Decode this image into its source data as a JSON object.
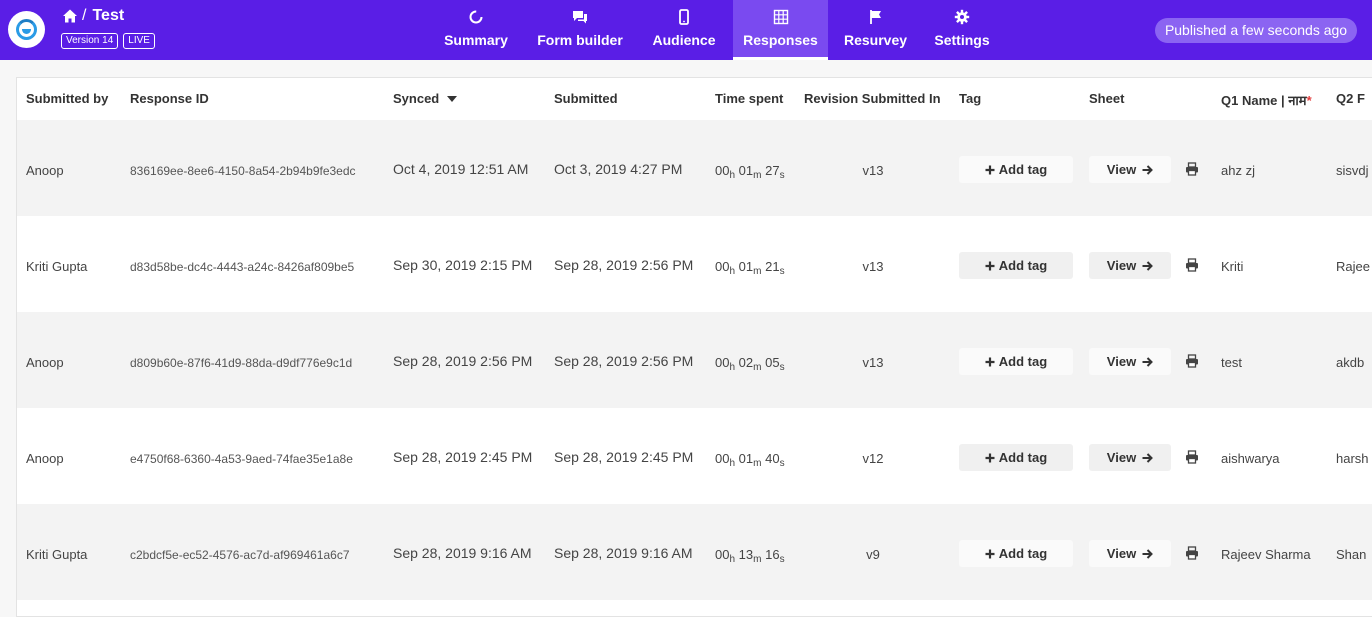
{
  "header": {
    "title": "Test",
    "version_badge": "Version 14",
    "live_badge": "LIVE",
    "published_status": "Published a few seconds ago",
    "colors": {
      "bar": "#5a1ee6",
      "active_tab": "#7a4af0",
      "pill": "#8b64f2"
    }
  },
  "nav": {
    "tabs": [
      {
        "label": "Summary",
        "icon": "summary-icon"
      },
      {
        "label": "Form builder",
        "icon": "chat-icon"
      },
      {
        "label": "Audience",
        "icon": "phone-icon"
      },
      {
        "label": "Responses",
        "icon": "grid-icon",
        "active": true
      },
      {
        "label": "Resurvey",
        "icon": "flag-icon"
      },
      {
        "label": "Settings",
        "icon": "gear-icon"
      }
    ]
  },
  "table": {
    "columns": {
      "submitted_by": "Submitted by",
      "response_id": "Response ID",
      "synced": "Synced",
      "submitted": "Submitted",
      "time_spent": "Time spent",
      "revision": "Revision Submitted In",
      "tag": "Tag",
      "sheet": "Sheet",
      "q1": "Q1 Name | नाम",
      "q1_required_mark": "*",
      "q2": "Q2 F"
    },
    "add_tag_label": "Add tag",
    "view_label": "View",
    "time_units": {
      "h": "h",
      "m": "m",
      "s": "s"
    },
    "rows": [
      {
        "submitted_by": "Anoop",
        "response_id": "836169ee-8ee6-4150-8a54-2b94b9fe3edc",
        "synced": "Oct 4, 2019 12:51 AM",
        "submitted": "Oct 3, 2019 4:27 PM",
        "t_h": "00",
        "t_m": "01",
        "t_s": "27",
        "revision": "v13",
        "q1": "ahz zj",
        "q2": "sisvdj"
      },
      {
        "submitted_by": "Kriti Gupta",
        "response_id": "d83d58be-dc4c-4443-a24c-8426af809be5",
        "synced": "Sep 30, 2019 2:15 PM",
        "submitted": "Sep 28, 2019 2:56 PM",
        "t_h": "00",
        "t_m": "01",
        "t_s": "21",
        "revision": "v13",
        "q1": "Kriti",
        "q2": "Rajee"
      },
      {
        "submitted_by": "Anoop",
        "response_id": "d809b60e-87f6-41d9-88da-d9df776e9c1d",
        "synced": "Sep 28, 2019 2:56 PM",
        "submitted": "Sep 28, 2019 2:56 PM",
        "t_h": "00",
        "t_m": "02",
        "t_s": "05",
        "revision": "v13",
        "q1": "test",
        "q2": "akdb"
      },
      {
        "submitted_by": "Anoop",
        "response_id": "e4750f68-6360-4a53-9aed-74fae35e1a8e",
        "synced": "Sep 28, 2019 2:45 PM",
        "submitted": "Sep 28, 2019 2:45 PM",
        "t_h": "00",
        "t_m": "01",
        "t_s": "40",
        "revision": "v12",
        "q1": "aishwarya",
        "q2": "harsh"
      },
      {
        "submitted_by": "Kriti Gupta",
        "response_id": "c2bdcf5e-ec52-4576-ac7d-af969461a6c7",
        "synced": "Sep 28, 2019 9:16 AM",
        "submitted": "Sep 28, 2019 9:16 AM",
        "t_h": "00",
        "t_m": "13",
        "t_s": "16",
        "revision": "v9",
        "q1": "Rajeev Sharma",
        "q2": "Shan"
      }
    ]
  }
}
